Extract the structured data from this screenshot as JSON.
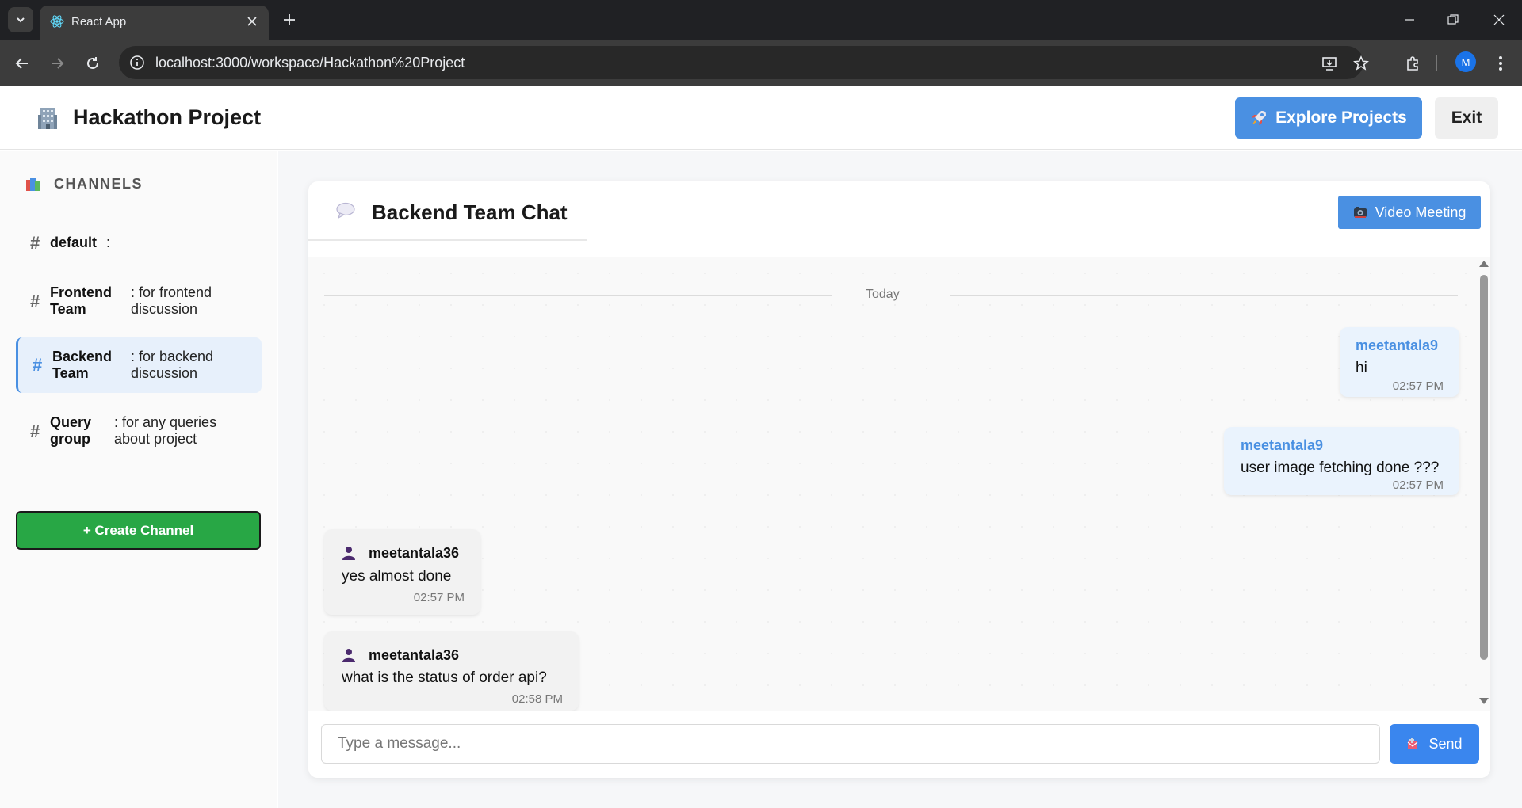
{
  "browser": {
    "tab_title": "React App",
    "url": "localhost:3000/workspace/Hackathon%20Project",
    "profile_initial": "M"
  },
  "header": {
    "title": "Hackathon Project",
    "explore_label": "Explore Projects",
    "exit_label": "Exit"
  },
  "sidebar": {
    "heading": "CHANNELS",
    "channels": [
      {
        "name": "default",
        "desc": ":"
      },
      {
        "name_line1": "Frontend",
        "name_line2": "Team",
        "desc_line1": ": for frontend",
        "desc_line2": "discussion"
      },
      {
        "name_line1": "Backend",
        "name_line2": "Team",
        "desc_line1": ": for backend",
        "desc_line2": "discussion",
        "active": true
      },
      {
        "name_line1": "Query",
        "name_line2": "group",
        "desc_line1": ": for any queries",
        "desc_line2": "about project"
      }
    ],
    "create_label": "+ Create Channel"
  },
  "chat": {
    "title": "Backend Team Chat",
    "video_label": "Video Meeting",
    "day_separator": "Today",
    "messages": [
      {
        "user": "meetantala9",
        "text": "hi",
        "time": "02:57 PM",
        "mine": true
      },
      {
        "user": "meetantala9",
        "text": "user image fetching done ???",
        "time": "02:57 PM",
        "mine": true
      },
      {
        "user": "meetantala36",
        "text": "yes almost done",
        "time": "02:57 PM",
        "mine": false
      },
      {
        "user": "meetantala36",
        "text": "what is the status of order api?",
        "time": "02:58 PM",
        "mine": false
      }
    ],
    "input_placeholder": "Type a message...",
    "send_label": "Send"
  },
  "colors": {
    "accent": "#4a90e2",
    "create_button": "#28a745",
    "own_bubble": "#eaf3fd",
    "other_bubble": "#f2f2f2"
  }
}
